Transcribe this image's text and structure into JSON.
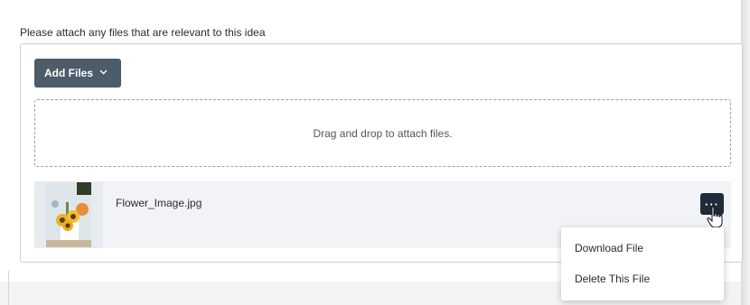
{
  "attachments": {
    "prompt": "Please attach any files that are relevant to this idea",
    "add_files_label": "Add Files",
    "add_files_icon": "chevron-down-icon",
    "dropzone_text": "Drag and drop to attach files.",
    "files": [
      {
        "name": "Flower_Image.jpg",
        "thumbnail": "flower-image-thumbnail"
      }
    ],
    "more_button_glyph": "···",
    "menu": {
      "items": [
        {
          "label": "Download File"
        },
        {
          "label": "Delete This File"
        }
      ]
    }
  },
  "colors": {
    "button_bg": "#4c5c68",
    "more_button_bg": "#1f2b38",
    "file_row_bg": "#f1f3f6"
  }
}
